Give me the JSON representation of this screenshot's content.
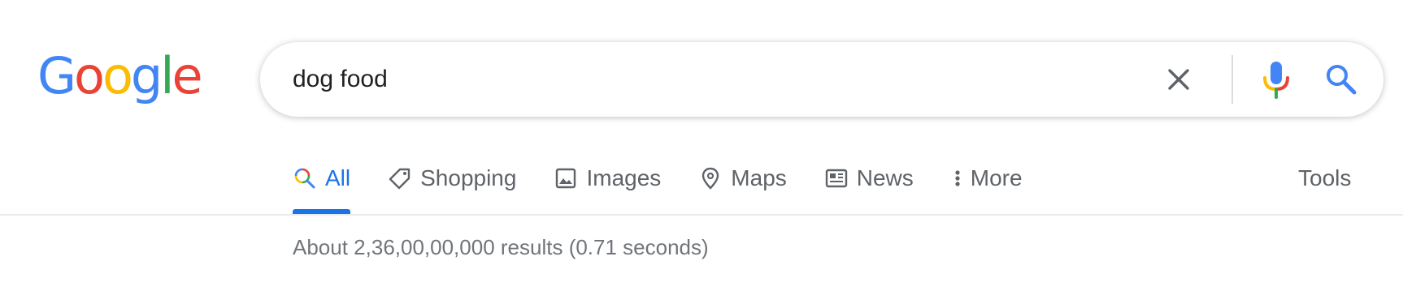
{
  "logo": {
    "letters": [
      "G",
      "o",
      "o",
      "g",
      "l",
      "e"
    ],
    "colors": [
      "#4285F4",
      "#EA4335",
      "#FBBC05",
      "#4285F4",
      "#34A853",
      "#EA4335"
    ]
  },
  "search": {
    "query": "dog food",
    "clear_icon": "close-icon",
    "voice_icon": "mic-icon",
    "submit_icon": "search-icon"
  },
  "tabs": [
    {
      "label": "All",
      "icon": "search-icon",
      "active": true
    },
    {
      "label": "Shopping",
      "icon": "tag-icon",
      "active": false
    },
    {
      "label": "Images",
      "icon": "image-icon",
      "active": false
    },
    {
      "label": "Maps",
      "icon": "map-pin-icon",
      "active": false
    },
    {
      "label": "News",
      "icon": "news-icon",
      "active": false
    },
    {
      "label": "More",
      "icon": "more-vert-icon",
      "active": false
    }
  ],
  "tools_label": "Tools",
  "result_stats": "About 2,36,00,00,000 results (0.71 seconds)",
  "colors": {
    "accent": "#1a73e8",
    "text_muted": "#5f6368",
    "stats": "#70757a"
  }
}
